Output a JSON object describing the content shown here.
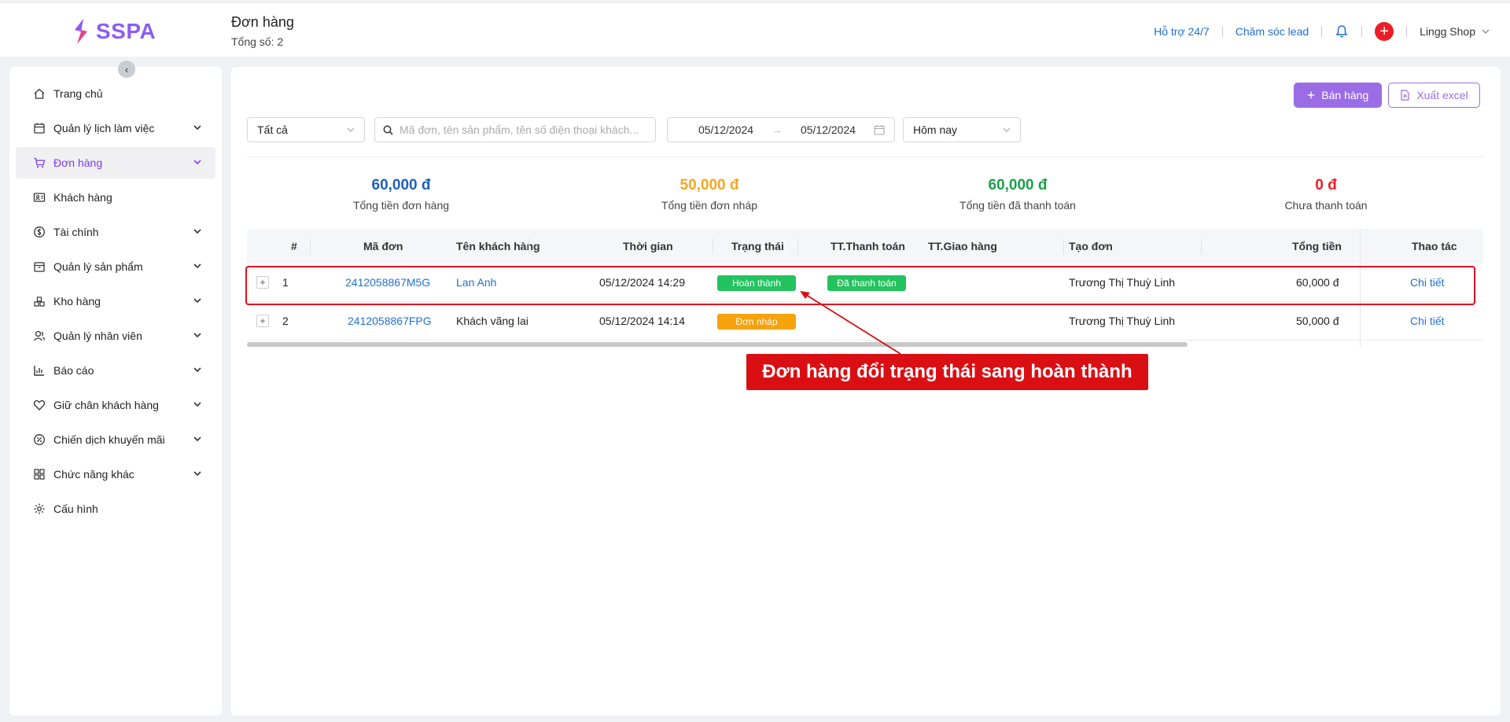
{
  "header": {
    "logo_text": "SSPA",
    "page_title": "Đơn hàng",
    "page_count": "Tổng số: 2",
    "support_link": "Hỗ trợ 24/7",
    "lead_link": "Chăm sóc lead",
    "shop_name": "Lingg Shop"
  },
  "sidebar": {
    "items": [
      {
        "label": "Trang chủ",
        "icon": "home-icon"
      },
      {
        "label": "Quản lý lịch làm việc",
        "icon": "calendar-icon"
      },
      {
        "label": "Đơn hàng",
        "icon": "cart-icon"
      },
      {
        "label": "Khách hàng",
        "icon": "contact-card-icon"
      },
      {
        "label": "Tài chính",
        "icon": "dollar-circle-icon"
      },
      {
        "label": "Quản lý sản phẩm",
        "icon": "box-icon"
      },
      {
        "label": "Kho hàng",
        "icon": "warehouse-icon"
      },
      {
        "label": "Quản lý nhân viên",
        "icon": "users-icon"
      },
      {
        "label": "Báo cáo",
        "icon": "bar-chart-icon"
      },
      {
        "label": "Giữ chân khách hàng",
        "icon": "heart-icon"
      },
      {
        "label": "Chiến dịch khuyến mãi",
        "icon": "discount-icon"
      },
      {
        "label": "Chức năng khác",
        "icon": "grid-icon"
      },
      {
        "label": "Cấu hình",
        "icon": "gear-icon"
      }
    ]
  },
  "toolbar": {
    "sell_label": "Bán hàng",
    "excel_label": "Xuất excel"
  },
  "filters": {
    "status_value": "Tất cả",
    "search_placeholder": "Mã đơn, tên sản phẩm, tên số điện thoại khách...",
    "date_from": "05/12/2024",
    "date_to": "05/12/2024",
    "date_arrow": "→",
    "range_value": "Hôm nay"
  },
  "stats": [
    {
      "value": "60,000 đ",
      "label": "Tổng tiền đơn hàng",
      "color": "#1f5fb8"
    },
    {
      "value": "50,000 đ",
      "label": "Tổng tiền đơn nháp",
      "color": "#f5a623"
    },
    {
      "value": "60,000 đ",
      "label": "Tổng tiền đã thanh toán",
      "color": "#1e9e4a"
    },
    {
      "value": "0 đ",
      "label": "Chưa thanh toán",
      "color": "#ee1c25"
    }
  ],
  "table": {
    "columns": [
      "#",
      "Mã đơn",
      "Tên khách hàng",
      "Thời gian",
      "Trạng thái",
      "TT.Thanh toán",
      "TT.Giao hàng",
      "Tạo đơn",
      "Tổng tiền",
      "Thao tác"
    ],
    "rows": [
      {
        "index": "1",
        "code": "2412058867M5G",
        "customer": "Lan Anh",
        "time": "05/12/2024 14:29",
        "status": "Hoàn thành",
        "status_color": "#22c35e",
        "payment": "Đã thanh toán",
        "payment_color": "#22c35e",
        "shipping": "",
        "creator": "Trương Thị Thuỳ Linh",
        "total": "60,000 đ",
        "action": "Chi tiết"
      },
      {
        "index": "2",
        "code": "2412058867FPG",
        "customer": "Khách vãng lai",
        "time": "05/12/2024 14:14",
        "status": "Đơn nháp",
        "status_color": "#f5a20b",
        "payment": "",
        "payment_color": "",
        "shipping": "",
        "creator": "Trương Thị Thuỳ Linh",
        "total": "50,000 đ",
        "action": "Chi tiết"
      }
    ]
  },
  "annotation": {
    "callout_text": "Đơn hàng đổi trạng thái sang hoàn thành",
    "color": "#d90f14"
  },
  "colors": {
    "accent": "#9b6ce6",
    "link": "#1f6fd6"
  }
}
